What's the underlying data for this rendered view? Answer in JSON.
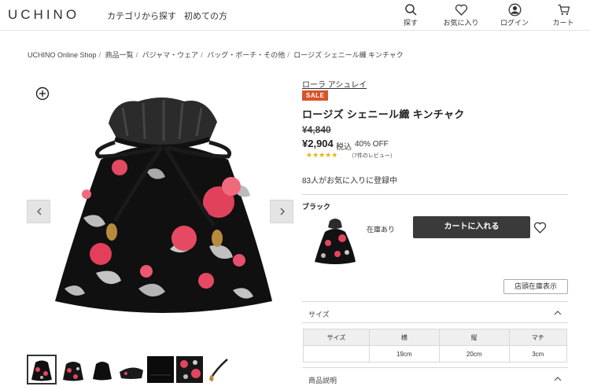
{
  "header": {
    "logo": "UCHINO",
    "nav": [
      "カテゴリから探す",
      "初めての方"
    ],
    "icons": [
      {
        "icon": "search-icon",
        "label": "探す"
      },
      {
        "icon": "heart-icon",
        "label": "お気に入り"
      },
      {
        "icon": "user-icon",
        "label": "ログイン"
      },
      {
        "icon": "cart-icon",
        "label": "カート"
      }
    ]
  },
  "breadcrumb": [
    "UCHINO Online Shop",
    "商品一覧",
    "パジャマ・ウェア",
    "バッグ・ポーチ・その他",
    "ロージズ シェニール織 キンチャク"
  ],
  "product": {
    "brand": "ローラ アシュレイ",
    "badge": "SALE",
    "title": "ロージズ シェニール織 キンチャク",
    "old_price": "¥4,840",
    "price": "¥2,904",
    "tax_label": "税込",
    "discount": "40% OFF",
    "stars": "★★★★★",
    "rating": 5,
    "review_count": "（7件のレビュー）",
    "favorites_text": "83人がお気に入りに登録中"
  },
  "variant": {
    "color": "ブラック",
    "stock": "在庫あり",
    "cart_button": "カートに入れる"
  },
  "store_button": "店頭在庫表示",
  "size_section": {
    "label": "サイズ",
    "table": {
      "headers": [
        "サイズ",
        "横",
        "縦",
        "マチ"
      ],
      "row": [
        "",
        "19cm",
        "20cm",
        "3cm"
      ]
    }
  },
  "description_section": {
    "label": "商品説明"
  },
  "gallery": {
    "thumbnail_count": 7,
    "active_index": 0
  },
  "colors": {
    "sale": "#d9532c",
    "cart_button": "#3a3a3a",
    "star": "#e6b400"
  }
}
